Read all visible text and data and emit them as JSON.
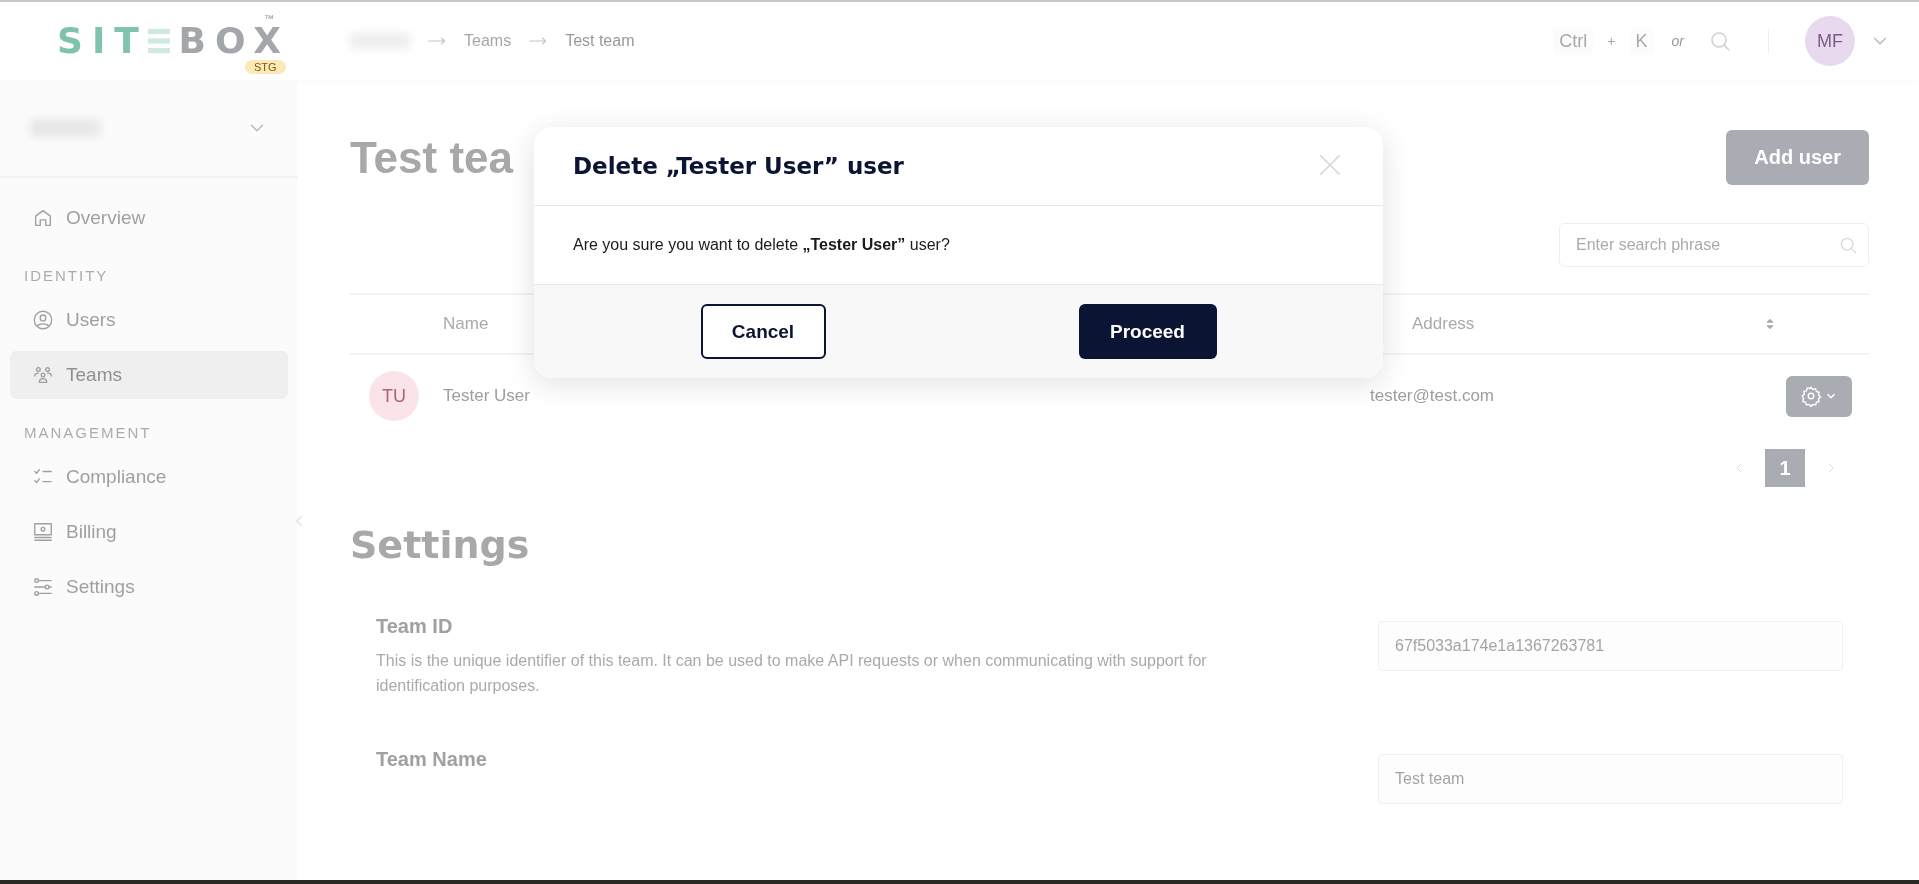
{
  "top_bar": {
    "logo": {
      "left": "SIT",
      "right": "BOX",
      "trademark": "™",
      "badge": "STG"
    },
    "breadcrumb": [
      "Teams",
      "Test team"
    ],
    "shortcut": {
      "keys": [
        "Ctrl",
        "K"
      ],
      "plus": "+",
      "or": "or"
    },
    "avatar": "MF"
  },
  "sidebar": {
    "items": [
      {
        "kind": "item",
        "label": "Overview",
        "selected": false
      },
      {
        "kind": "heading",
        "label": "IDENTITY"
      },
      {
        "kind": "item",
        "label": "Users",
        "selected": false
      },
      {
        "kind": "item",
        "label": "Teams",
        "selected": true
      },
      {
        "kind": "heading",
        "label": "MANAGEMENT"
      },
      {
        "kind": "item",
        "label": "Compliance",
        "selected": false
      },
      {
        "kind": "item",
        "label": "Billing",
        "selected": false
      },
      {
        "kind": "item",
        "label": "Settings",
        "selected": false
      }
    ]
  },
  "page": {
    "title": "Test tea",
    "add_button": "Add user",
    "search": {
      "placeholder": "Enter search phrase"
    }
  },
  "table": {
    "columns": [
      {
        "label": "Name"
      },
      {
        "label": "Address",
        "sortable": true
      }
    ],
    "rows": [
      {
        "initials": "TU",
        "name": "Tester User",
        "email": "tester@test.com"
      }
    ],
    "pages": [
      {
        "label": "1",
        "selected": true
      }
    ]
  },
  "settings": {
    "title": "Settings",
    "fields": [
      {
        "label": "Team ID",
        "description": "This is the unique identifier of this team. It can be used to make API requests or when communicating with support for identification purposes.",
        "value": "67f5033a174e1a1367263781"
      },
      {
        "label": "Team Name",
        "value": "Test team"
      }
    ]
  },
  "dialog": {
    "title": "Delete „Tester User” user",
    "message": "Are you sure you want to delete **„Tester User”** user?",
    "cancel": "Cancel",
    "proceed": "Proceed"
  }
}
